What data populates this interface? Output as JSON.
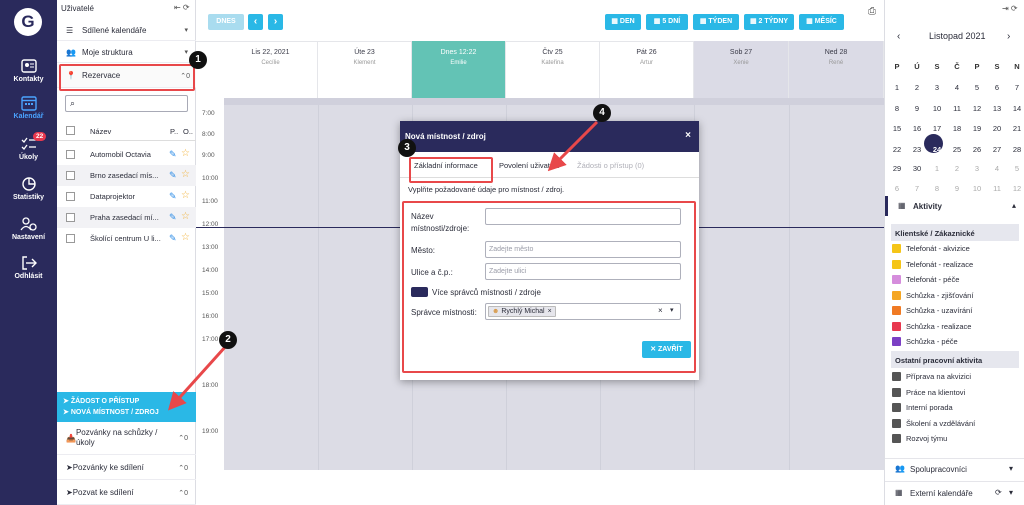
{
  "nav": {
    "logo": "G",
    "items": [
      {
        "label": "Kontakty",
        "icon": "contacts-icon"
      },
      {
        "label": "Kalendář",
        "icon": "calendar-icon"
      },
      {
        "label": "Úkoly",
        "icon": "tasks-icon",
        "badge": "22"
      },
      {
        "label": "Statistiky",
        "icon": "statistics-icon"
      },
      {
        "label": "Nastavení",
        "icon": "settings-icon"
      },
      {
        "label": "Odhlásit",
        "icon": "logout-icon"
      }
    ]
  },
  "left_panel": {
    "users_label": "Uživatelé",
    "shared_calendars": "Sdílené kalendáře",
    "my_structure": "Moje struktura",
    "reservations": "Rezervace",
    "reservations_count": "0",
    "table_headers": {
      "name": "Název",
      "p": "P..",
      "o": "O.."
    },
    "resources": [
      {
        "name": "Automobil Octavia"
      },
      {
        "name": "Brno zasedací mís..."
      },
      {
        "name": "Dataprojektor"
      },
      {
        "name": "Praha zasedací mí..."
      },
      {
        "name": "Školící centrum U li..."
      }
    ],
    "request_access": "ŽÁDOST O PŘÍSTUP",
    "new_room": "NOVÁ MÍSTNOST / ZDROJ",
    "invitations_meetings": "Pozvánky na schůzky / úkoly",
    "invitations_meetings_count": "0",
    "invitations_sharing": "Pozvánky ke sdílení",
    "invitations_sharing_count": "0",
    "invite_sharing": "Pozvat ke sdílení",
    "invite_sharing_count": "0"
  },
  "toolbar": {
    "today": "DNES",
    "prev": "‹",
    "next": "›",
    "views": [
      "DEN",
      "5 DNÍ",
      "TÝDEN",
      "2 TÝDNY",
      "MĚSÍC"
    ]
  },
  "days": [
    {
      "day": "Lis 22, 2021",
      "person": "Cecílie"
    },
    {
      "day": "Úte 23",
      "person": "Klement"
    },
    {
      "day": "Dnes 12:22",
      "person": "Emilie"
    },
    {
      "day": "Čtv 25",
      "person": "Kateřina"
    },
    {
      "day": "Pát 26",
      "person": "Artur"
    },
    {
      "day": "Sob 27",
      "person": "Xenie"
    },
    {
      "day": "Ned 28",
      "person": "René"
    }
  ],
  "times": [
    "7:00",
    "8:00",
    "9:00",
    "10:00",
    "11:00",
    "12:00",
    "13:00",
    "14:00",
    "15:00",
    "16:00",
    "17:00",
    "18:00",
    "19:00"
  ],
  "modal": {
    "title": "Nová místnost / zdroj",
    "close": "×",
    "tabs": [
      "Základní informace",
      "Povolení uživatelé",
      "Žádosti o přístup  (0)"
    ],
    "description": "Vyplňte požadované údaje pro místnost / zdroj.",
    "name_label": "Název místnosti/zdroje:",
    "name_value": "",
    "city_label": "Město:",
    "city_placeholder": "Zadejte město",
    "street_label": "Ulice a č.p.:",
    "street_placeholder": "Zadejte ulici",
    "multi_admins": "Více správců místnosti / zdroje",
    "admin_label": "Správce místnosti:",
    "admin_chip": "Rychlý Michal",
    "close_button": "ZAVŘÍT"
  },
  "annotations": [
    "1",
    "2",
    "3",
    "4"
  ],
  "right_panel": {
    "month": "Listopad 2021",
    "weekdays": [
      "P",
      "Ú",
      "S",
      "Č",
      "P",
      "S",
      "N"
    ],
    "weeks": [
      [
        "1",
        "2",
        "3",
        "4",
        "5",
        "6",
        "7"
      ],
      [
        "8",
        "9",
        "10",
        "11",
        "12",
        "13",
        "14"
      ],
      [
        "15",
        "16",
        "17",
        "18",
        "19",
        "20",
        "21"
      ],
      [
        "22",
        "23",
        "24",
        "25",
        "26",
        "27",
        "28"
      ],
      [
        "29",
        "30",
        "1",
        "2",
        "3",
        "4",
        "5"
      ],
      [
        "6",
        "7",
        "8",
        "9",
        "10",
        "11",
        "12"
      ]
    ],
    "activities": "Aktivity",
    "client_section": "Klientské / Zákaznické",
    "client_items": [
      {
        "label": "Telefonát - akvizice",
        "color": "#f5c518"
      },
      {
        "label": "Telefonát - realizace",
        "color": "#f5c518"
      },
      {
        "label": "Telefonát - péče",
        "color": "#d58ddc"
      },
      {
        "label": "Schůzka - zjišťování",
        "color": "#f5a623"
      },
      {
        "label": "Schůzka - uzavírání",
        "color": "#f07a24"
      },
      {
        "label": "Schůzka - realizace",
        "color": "#e8384f"
      },
      {
        "label": "Schůzka - péče",
        "color": "#7b3fc4"
      }
    ],
    "other_section": "Ostatní pracovní aktivita",
    "other_items": [
      {
        "label": "Příprava na akvizici",
        "color": "#555555"
      },
      {
        "label": "Práce na klientovi",
        "color": "#555555"
      },
      {
        "label": "Interní porada",
        "color": "#555555"
      },
      {
        "label": "Školení a vzdělávání",
        "color": "#555555"
      },
      {
        "label": "Rozvoj týmu",
        "color": "#555555"
      }
    ],
    "collaborators": "Spolupracovníci",
    "external": "Externí kalendáře"
  }
}
